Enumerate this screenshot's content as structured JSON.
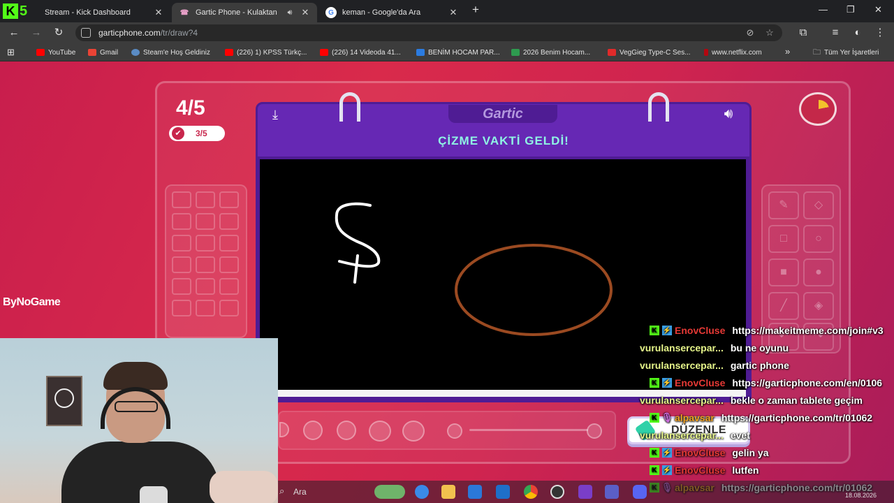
{
  "browser": {
    "tabs": [
      {
        "title": "Stream - Kick Dashboard",
        "favicon": "kick-icon"
      },
      {
        "title": "Gartic Phone - Kulaktan Kul",
        "favicon": "gartic-icon"
      },
      {
        "title": "keman - Google'da Ara",
        "favicon": "google-icon"
      }
    ],
    "kick_counter": "5",
    "url_host": "garticphone.com",
    "url_path": "/tr/draw?4"
  },
  "bookmarks": [
    {
      "label": "YouTube",
      "color": "#ff0000"
    },
    {
      "label": "Gmail",
      "color": "#ea4335"
    },
    {
      "label": "Steam'e Hoş Geldiniz",
      "color": "#5a8bc4"
    },
    {
      "label": "(226) 1) KPSS Türkç...",
      "color": "#ff0000"
    },
    {
      "label": "(226) 14 Videoda 41...",
      "color": "#ff0000"
    },
    {
      "label": "BENİM HOCAM PAR...",
      "color": "#2b7be0"
    },
    {
      "label": "2026 Benim Hocam...",
      "color": "#2e9b4f"
    },
    {
      "label": "VegGieg Type-C Ses...",
      "color": "#e02a2a"
    },
    {
      "label": "www.netflix.com",
      "color": "#b20710"
    }
  ],
  "bookmarks_more": "»",
  "bookmarks_folder": "Tüm Yer İşaretleri",
  "game": {
    "round": "4/5",
    "completed": "3/5",
    "brand": "Gartic",
    "headline": "ÇİZME VAKTİ GELDİ!",
    "edit_button": "DÜZENLE",
    "timer_fraction": 0.22,
    "canvas_background": "#000000",
    "accent": "#6628b4",
    "drawing": {
      "letter_stroke_color": "#ffffff",
      "ellipse_stroke_color": "#9b4a21"
    }
  },
  "overlay": {
    "watermark": "ByNoGame"
  },
  "chat": [
    {
      "user": "EnovCluse",
      "user_color": "#e53935",
      "badges": [
        "k",
        "s"
      ],
      "text": "https://makeitmeme.com/join#v3"
    },
    {
      "user": "vurulansercepar...",
      "user_color": "#e6f58a",
      "badges": [],
      "text": "bu ne oyunu"
    },
    {
      "user": "vurulansercepar...",
      "user_color": "#e6f58a",
      "badges": [],
      "text": "gartic phone"
    },
    {
      "user": "EnovCluse",
      "user_color": "#e53935",
      "badges": [
        "k",
        "s"
      ],
      "text": "https://garticphone.com/en/0106"
    },
    {
      "user": "vurulansercepar...",
      "user_color": "#e6f58a",
      "badges": [],
      "text": "bekle o zaman tablete geçim"
    },
    {
      "user": "alpavsar",
      "user_color": "#f0a020",
      "badges": [
        "k",
        "m"
      ],
      "text": "https://garticphone.com/tr/01062"
    },
    {
      "user": "vurulansercepar...",
      "user_color": "#e6f58a",
      "badges": [],
      "text": "evet"
    },
    {
      "user": "EnovCluse",
      "user_color": "#e53935",
      "badges": [
        "k",
        "s"
      ],
      "text": "gelin ya"
    },
    {
      "user": "EnovCluse",
      "user_color": "#e53935",
      "badges": [
        "k",
        "s"
      ],
      "text": "lutfen"
    },
    {
      "user": "alpavsar",
      "user_color": "#f0a020",
      "badges": [
        "k",
        "m"
      ],
      "text": "https://garticphone.com/tr/01062"
    }
  ],
  "taskbar": {
    "search_label": "Ara",
    "date": "18.08.2026"
  }
}
